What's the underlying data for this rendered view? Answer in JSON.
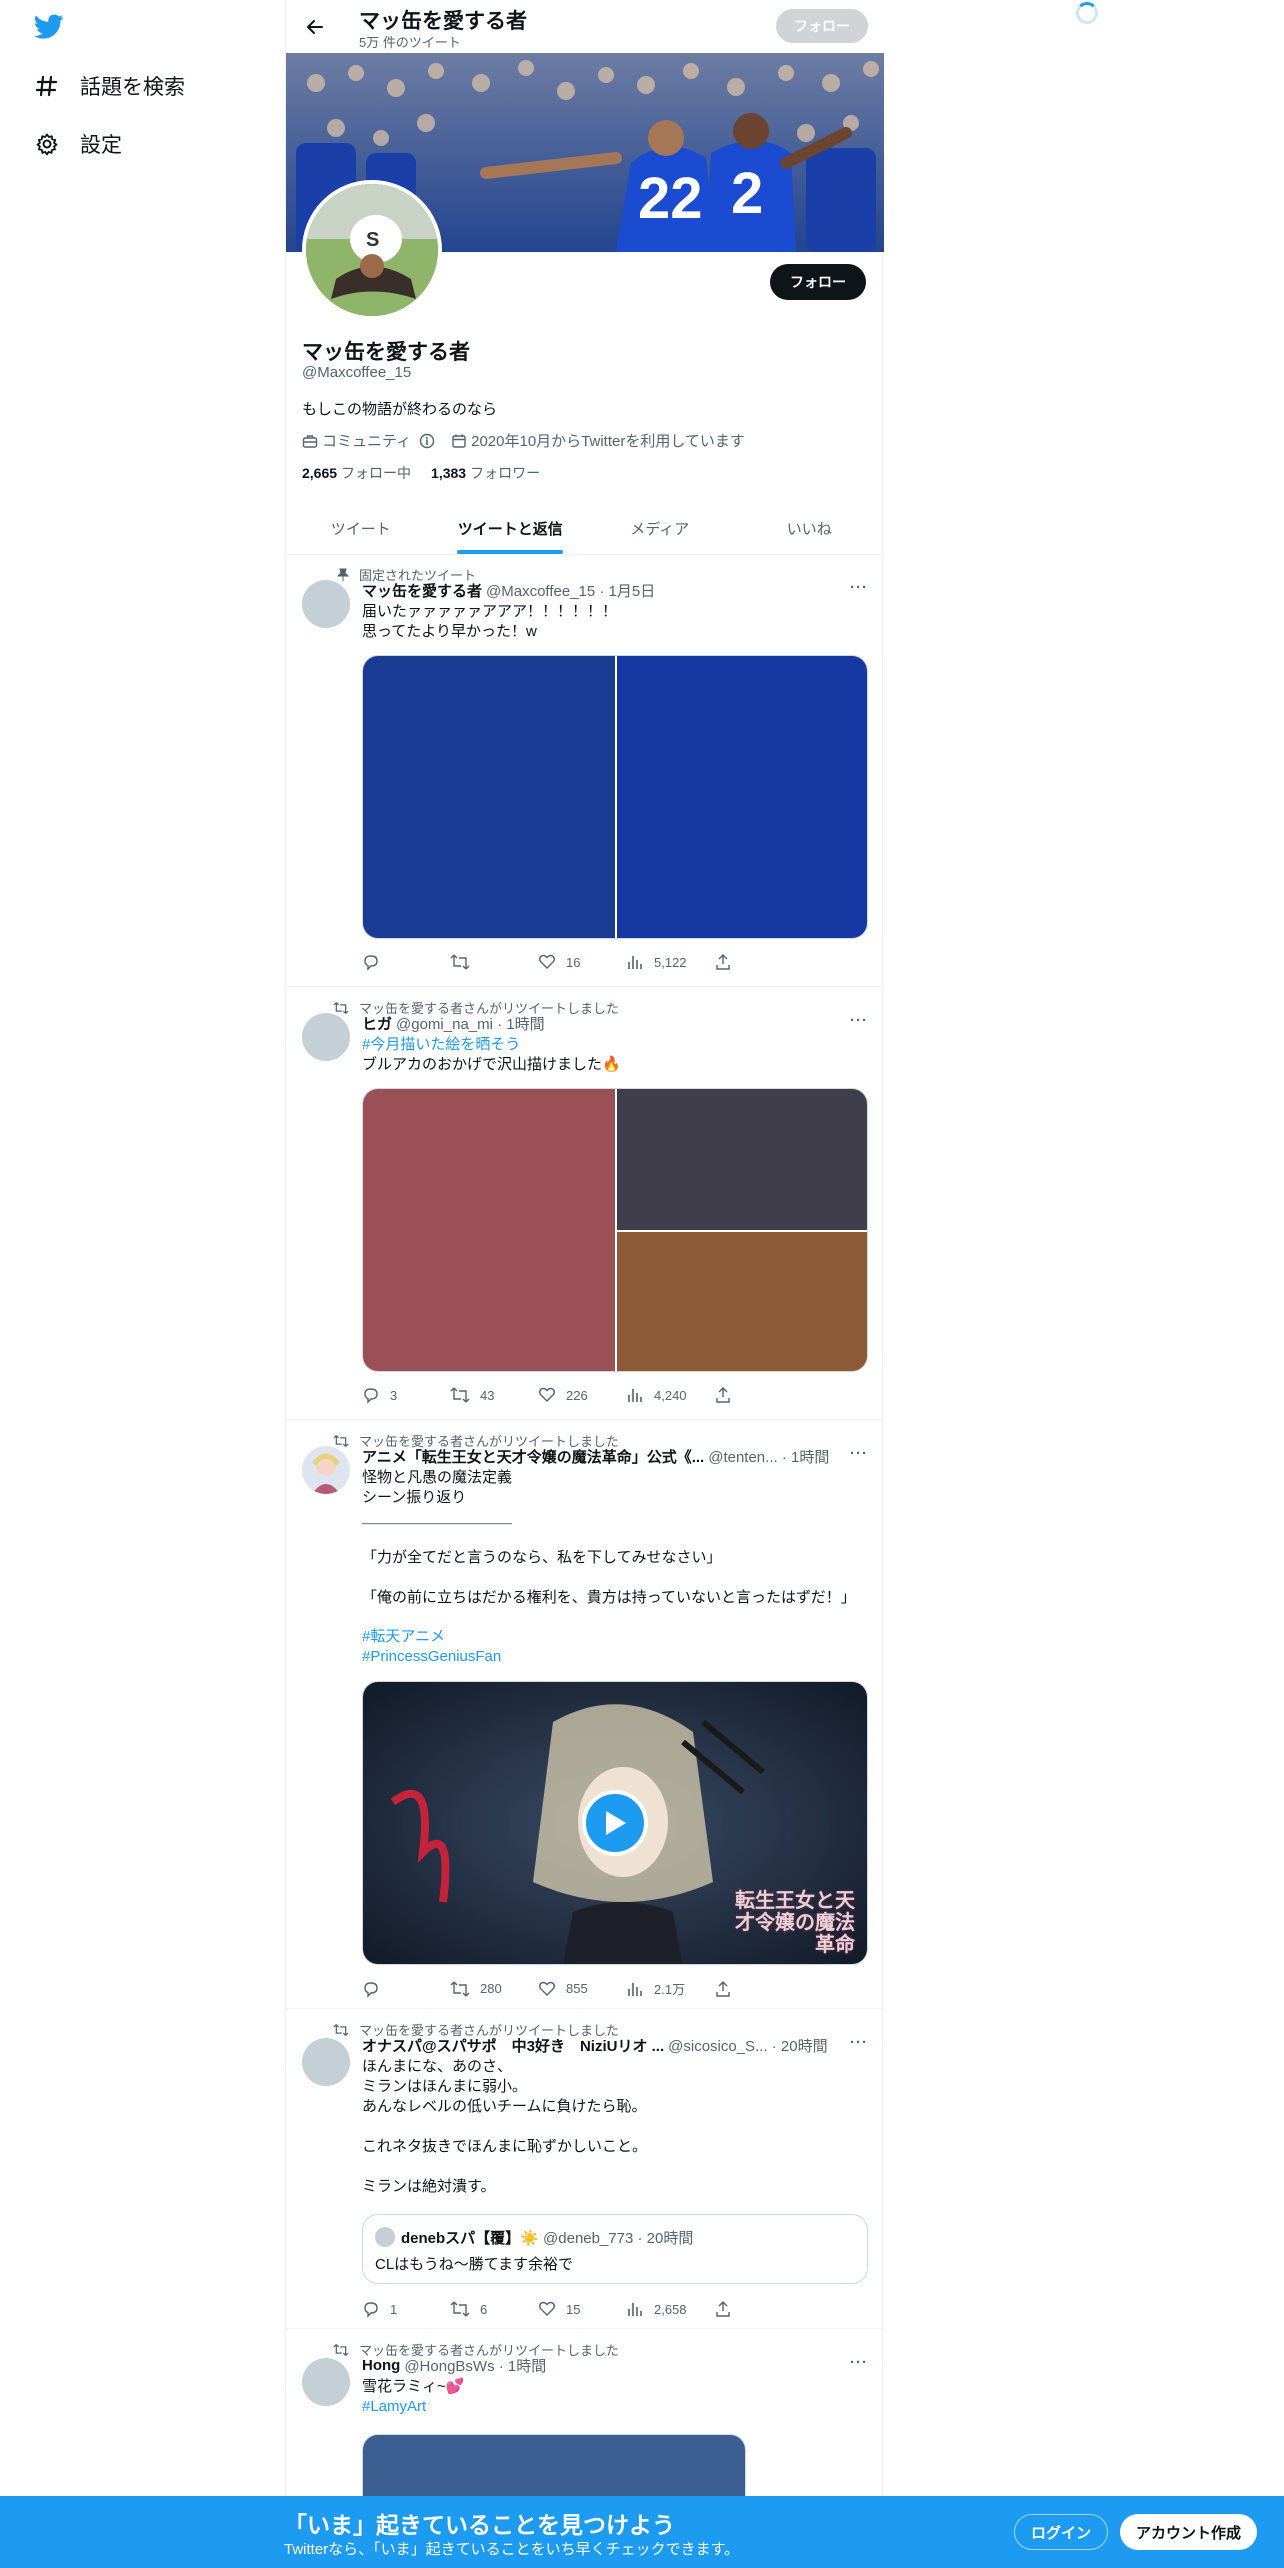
{
  "nav": {
    "items": [
      {
        "label": "話題を検索",
        "icon": "hashtag-icon"
      },
      {
        "label": "設定",
        "icon": "gear-icon"
      }
    ]
  },
  "header": {
    "name": "マッ缶を愛する者",
    "tweet_count": "5万 件のツイート",
    "follow_label": "フォロー"
  },
  "profile": {
    "name": "マッ缶を愛する者",
    "handle": "@Maxcoffee_15",
    "bio": "もしこの物語が終わるのなら",
    "category": "コミュニティ",
    "joined": "2020年10月からTwitterを利用しています",
    "following_count": "2,665",
    "following_label": "フォロー中",
    "followers_count": "1,383",
    "followers_label": "フォロワー",
    "follow_label": "フォロー"
  },
  "tabs": [
    "ツイート",
    "ツイートと返信",
    "メディア",
    "いいね"
  ],
  "tweets": [
    {
      "context": "固定されたツイート",
      "name": "マッ缶を愛する者",
      "meta": "@Maxcoffee_15 · 1月5日",
      "text": "届いたァァァァァアアア！！！！！！\n思ってたより早かった！w",
      "replies": "",
      "retweets": "",
      "likes": "16",
      "views": "5,122"
    },
    {
      "context": "マッ缶を愛する者さんがリツイートしました",
      "name": "ヒガ",
      "meta": "@gomi_na_mi · 1時間",
      "hashtag": "#今月描いた絵を晒そう",
      "text": "ブルアカのおかげで沢山描けました🔥",
      "replies": "3",
      "retweets": "43",
      "likes": "226",
      "views": "4,240"
    },
    {
      "context": "マッ缶を愛する者さんがリツイートしました",
      "name": "アニメ「転生王女と天才令嬢の魔法革命」公式《...",
      "meta": "@tenten... · 1時間",
      "text": "怪物と凡愚の魔法定義\nシーン振り返り\n＿＿＿＿＿＿＿＿＿＿\n\n「力が全てだと言うのなら、私を下してみせなさい」\n\n「俺の前に立ちはだかる権利を、貴方は持っていないと言ったはずだ！」",
      "hashtag1": "#転天アニメ",
      "hashtag2": "#PrincessGeniusFan",
      "video_caption": "転生王女と天才令嬢の魔法革命",
      "replies": "",
      "retweets": "280",
      "likes": "855",
      "views": "2.1万"
    },
    {
      "context": "マッ缶を愛する者さんがリツイートしました",
      "name": "オナスパ@スパサポ　中3好き　NiziUリオ ...",
      "meta": "@sicosico_S... · 20時間",
      "text": "ほんまにな、あのさ、\nミランはほんまに弱小。\nあんなレベルの低いチームに負けたら恥。\n\nこれネタ抜きでほんまに恥ずかしいこと。\n\nミランは絶対潰す。",
      "quote_name": "denebスパ【覆】☀️",
      "quote_meta": "@deneb_773 · 20時間",
      "quote_text": "CLはもうね〜勝てます余裕で",
      "replies": "1",
      "retweets": "6",
      "likes": "15",
      "views": "2,658"
    },
    {
      "context": "マッ缶を愛する者さんがリツイートしました",
      "name": "Hong",
      "meta": "@HongBsWs · 1時間",
      "text": "雪花ラミィ~💕",
      "hashtag": "#LamyArt"
    }
  ],
  "bottom": {
    "title": "「いま」起きていることを見つけよう",
    "subtitle": "Twitterなら、「いま」起きていることをいち早くチェックできます。",
    "login": "ログイン",
    "signup": "アカウント作成"
  },
  "colors": {
    "accent": "#1d9bf0",
    "text": "#0f1419",
    "muted": "#536471"
  }
}
